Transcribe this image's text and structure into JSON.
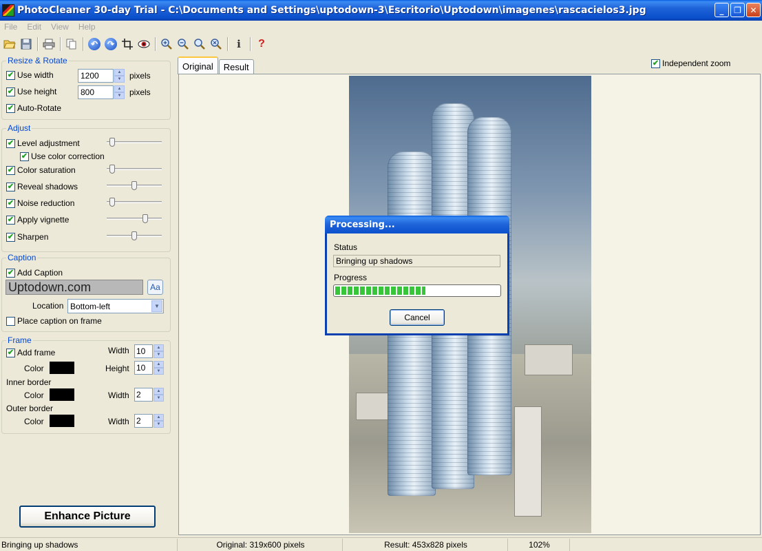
{
  "window": {
    "title": "PhotoCleaner 30-day Trial - C:\\Documents and Settings\\uptodown-3\\Escritorio\\Uptodown\\imagenes\\rascacielos3.jpg"
  },
  "menu": [
    "File",
    "Edit",
    "View",
    "Help"
  ],
  "toolbar": {
    "icons": [
      "open-folder-icon",
      "save-icon",
      "print-icon",
      "copy-icon",
      "rotate-left-icon",
      "rotate-right-icon",
      "crop-icon",
      "preview-eye-icon",
      "zoom-in-icon",
      "zoom-out-icon",
      "zoom-fit-icon",
      "zoom-actual-icon",
      "info-icon",
      "help-icon"
    ],
    "info_glyph": "i",
    "help_glyph": "?"
  },
  "resize": {
    "title": "Resize & Rotate",
    "use_width": {
      "label": "Use width",
      "value": "1200",
      "unit": "pixels",
      "checked": true
    },
    "use_height": {
      "label": "Use height",
      "value": "800",
      "unit": "pixels",
      "checked": true
    },
    "auto_rotate": {
      "label": "Auto-Rotate",
      "checked": true
    }
  },
  "adjust": {
    "title": "Adjust",
    "level": {
      "label": "Level adjustment",
      "checked": true,
      "level": 0.05
    },
    "color_correction": {
      "label": "Use color correction",
      "checked": true
    },
    "saturation": {
      "label": "Color saturation",
      "checked": true,
      "level": 0.05
    },
    "shadows": {
      "label": "Reveal shadows",
      "checked": true,
      "level": 0.5
    },
    "noise": {
      "label": "Noise reduction",
      "checked": true,
      "level": 0.05
    },
    "vignette": {
      "label": "Apply vignette",
      "checked": true,
      "level": 0.72
    },
    "sharpen": {
      "label": "Sharpen",
      "checked": true,
      "level": 0.5
    }
  },
  "caption": {
    "title": "Caption",
    "add": {
      "label": "Add Caption",
      "checked": true
    },
    "text": "Uptodown.com",
    "font_button": "Aa",
    "location_label": "Location",
    "location_value": "Bottom-left",
    "on_frame": {
      "label": "Place caption on frame",
      "checked": false
    }
  },
  "frame": {
    "title": "Frame",
    "add": {
      "label": "Add frame",
      "checked": true
    },
    "color_label": "Color",
    "width_label": "Width",
    "height_label": "Height",
    "frame_width": "10",
    "frame_height": "10",
    "inner_border_label": "Inner border",
    "inner_width": "2",
    "outer_border_label": "Outer border",
    "outer_width": "2",
    "color": "#000000"
  },
  "enhance_button": "Enhance Picture",
  "viewer": {
    "tabs": [
      "Original",
      "Result"
    ],
    "independent_zoom": {
      "label": "Independent zoom",
      "checked": true
    }
  },
  "dialog": {
    "title": "Processing...",
    "status_label": "Status",
    "status_value": "Bringing up shadows",
    "progress_label": "Progress",
    "progress": 0.55,
    "cancel": "Cancel"
  },
  "statusbar": {
    "message": "Bringing up shadows",
    "original": "Original: 319x600 pixels",
    "result": "Result: 453x828 pixels",
    "zoom": "102%"
  }
}
